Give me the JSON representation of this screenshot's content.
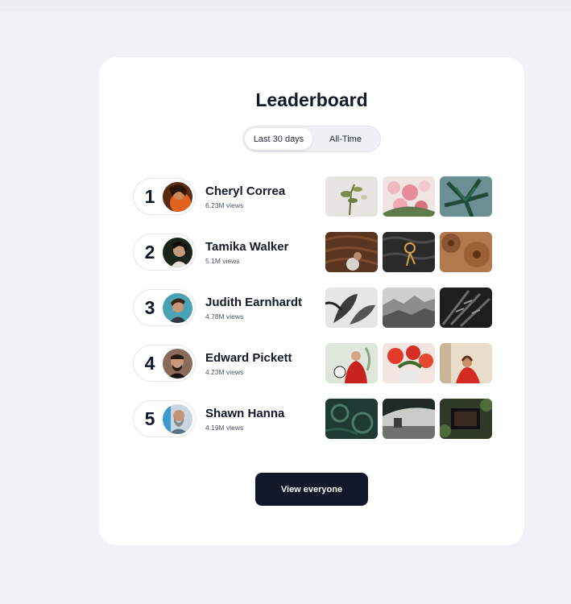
{
  "leaderboard": {
    "title": "Leaderboard",
    "tabs": [
      {
        "label": "Last 30 days",
        "active": true
      },
      {
        "label": "All-Time",
        "active": false
      }
    ],
    "view_all_label": "View everyone",
    "entries": [
      {
        "rank": "1",
        "name": "Cheryl Correa",
        "views": "6.23M views"
      },
      {
        "rank": "2",
        "name": "Tamika Walker",
        "views": "5.1M views"
      },
      {
        "rank": "3",
        "name": "Judith Earnhardt",
        "views": "4.78M views"
      },
      {
        "rank": "4",
        "name": "Edward Pickett",
        "views": "4.23M views"
      },
      {
        "rank": "5",
        "name": "Shawn Hanna",
        "views": "4.19M views"
      }
    ]
  },
  "colors": {
    "page_bg": "#f1f2f6",
    "card_bg": "#ffffff",
    "text_dark": "#111827",
    "button_bg": "#121829",
    "button_text": "#ffffff"
  }
}
